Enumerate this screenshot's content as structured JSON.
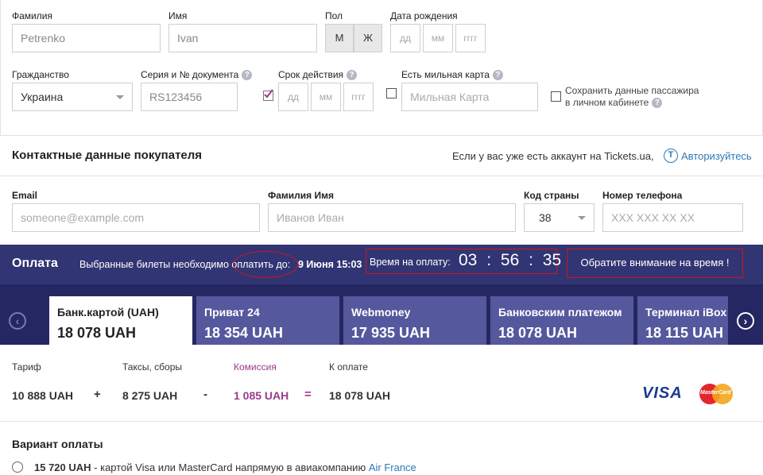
{
  "passenger": {
    "surname_label": "Фамилия",
    "surname_value": "Petrenko",
    "name_label": "Имя",
    "name_value": "Ivan",
    "gender_label": "Пол",
    "gender_m": "М",
    "gender_f": "Ж",
    "birth_label": "Дата рождения",
    "dd": "дд",
    "mm": "мм",
    "yyyy": "гггг",
    "citizenship_label": "Гражданство",
    "citizenship_value": "Украина",
    "doc_label": "Серия и № документа",
    "doc_value": "RS123456",
    "validity_label": "Срок действия",
    "mileage_label": "Есть мильная карта",
    "mileage_placeholder": "Мильная Карта",
    "save_line1": "Сохранить данные пассажира",
    "save_line2": "в личном кабинете",
    "help_glyph": "?"
  },
  "contact": {
    "title": "Контактные данные покупателя",
    "account_text": "Если у вас уже есть аккаунт на Tickets.ua,",
    "login_icon_glyph": "T",
    "login_link": "Авторизуйтесь",
    "email_label": "Email",
    "email_placeholder": "someone@example.com",
    "fullname_label": "Фамилия Имя",
    "fullname_placeholder": "Иванов Иван",
    "country_code_label": "Код страны",
    "country_code_value": "38",
    "phone_label": "Номер телефона",
    "phone_placeholder": "XXX XXX XX XX"
  },
  "payment": {
    "title": "Оплата",
    "notice": "Выбранные билеты необходимо оплатить до:",
    "deadline": "9 Июня 15:03",
    "time_label": "Время на оплату:",
    "timer_h": "03",
    "timer_m": "56",
    "timer_s": "35",
    "timer_sep": ":",
    "attention": "Обратите внимание на время !",
    "tabs": [
      {
        "label": "Банк.картой (UAH)",
        "price": "18 078 UAH"
      },
      {
        "label": "Приват 24",
        "price": "18 354 UAH"
      },
      {
        "label": "Webmoney",
        "price": "17 935 UAH"
      },
      {
        "label": "Банковским платежом",
        "price": "18 078 UAH"
      },
      {
        "label": "Терминал iBox",
        "price": "18 115 UAH"
      }
    ],
    "prev_glyph": "‹",
    "next_glyph": "›"
  },
  "summary": {
    "tariff_label": "Тариф",
    "tariff_value": "10 888 UAH",
    "taxes_label": "Таксы, сборы",
    "taxes_value": "8 275 UAH",
    "commission_label": "Комиссия",
    "commission_value": "1 085 UAH",
    "total_label": "К оплате",
    "total_value": "18 078 UAH",
    "plus": "+",
    "minus": "-",
    "equals": "=",
    "visa": "VISA",
    "mastercard": "MasterCard"
  },
  "variant": {
    "title": "Вариант оплаты",
    "option_price": "15 720 UAH",
    "option_text": " - картой Visa или MasterCard напрямую в авиакомпанию ",
    "option_airline": "Air France"
  },
  "colors": {
    "accent_blue": "#2a7ab8",
    "bar_bg": "#323573",
    "tab_bg": "#56589e",
    "highlight_red": "#d0141e",
    "commission_purple": "#9b3a8c"
  }
}
